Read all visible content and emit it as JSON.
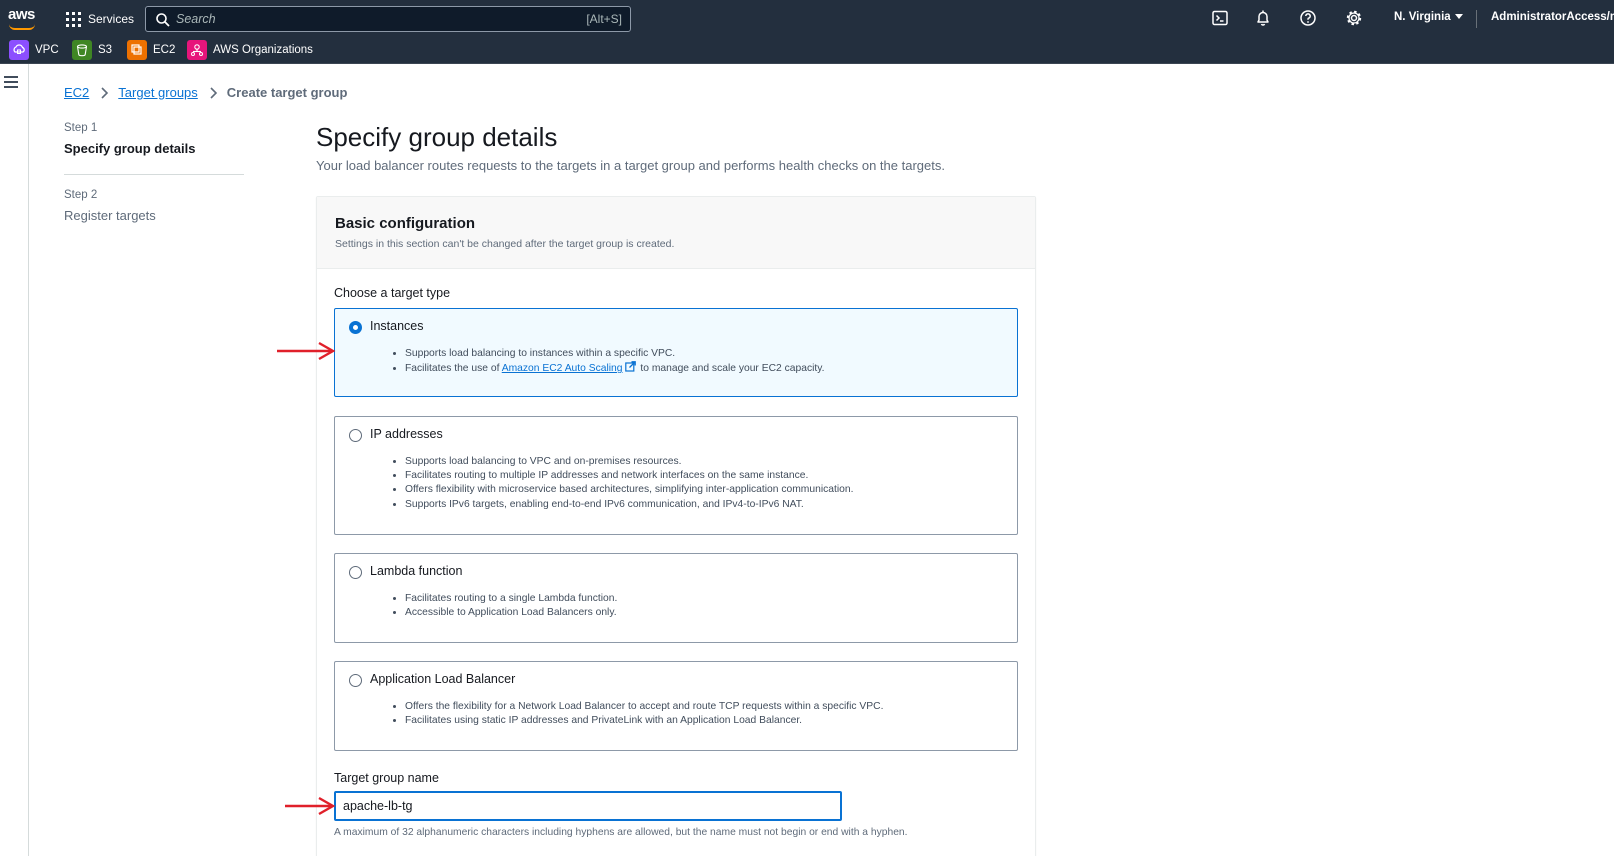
{
  "topnav": {
    "logo_text": "aws",
    "services_label": "Services",
    "search_placeholder": "Search",
    "search_shortcut": "[Alt+S]",
    "region": "N. Virginia",
    "account": "AdministratorAccess/my",
    "icons": [
      "cloudshell-icon",
      "notifications-icon",
      "help-icon",
      "settings-icon"
    ]
  },
  "favorites": [
    {
      "label": "VPC",
      "color": "#8c4fff"
    },
    {
      "label": "S3",
      "color": "#3f8624"
    },
    {
      "label": "EC2",
      "color": "#ed7100"
    },
    {
      "label": "AWS Organizations",
      "color": "#e7157b"
    }
  ],
  "breadcrumb": {
    "items": [
      "EC2",
      "Target groups"
    ],
    "current": "Create target group"
  },
  "steps": [
    {
      "label": "Step 1",
      "title": "Specify group details",
      "active": true
    },
    {
      "label": "Step 2",
      "title": "Register targets",
      "active": false
    }
  ],
  "main": {
    "title": "Specify group details",
    "description": "Your load balancer routes requests to the targets in a target group and performs health checks on the targets."
  },
  "panel": {
    "title": "Basic configuration",
    "subtitle": "Settings in this section can't be changed after the target group is created.",
    "target_type_label": "Choose a target type",
    "target_types": [
      {
        "title": "Instances",
        "selected": true,
        "bullets": [
          "Supports load balancing to instances within a specific VPC."
        ],
        "link_bullet": {
          "prefix": "Facilitates the use of ",
          "link": "Amazon EC2 Auto Scaling",
          "suffix": " to manage and scale your EC2 capacity."
        }
      },
      {
        "title": "IP addresses",
        "selected": false,
        "bullets": [
          "Supports load balancing to VPC and on-premises resources.",
          "Facilitates routing to multiple IP addresses and network interfaces on the same instance.",
          "Offers flexibility with microservice based architectures, simplifying inter-application communication.",
          "Supports IPv6 targets, enabling end-to-end IPv6 communication, and IPv4-to-IPv6 NAT."
        ]
      },
      {
        "title": "Lambda function",
        "selected": false,
        "bullets": [
          "Facilitates routing to a single Lambda function.",
          "Accessible to Application Load Balancers only."
        ]
      },
      {
        "title": "Application Load Balancer",
        "selected": false,
        "bullets": [
          "Offers the flexibility for a Network Load Balancer to accept and route TCP requests within a specific VPC.",
          "Facilitates using static IP addresses and PrivateLink with an Application Load Balancer."
        ]
      }
    ],
    "name_label": "Target group name",
    "name_value": "apache-lb-tg",
    "name_constraint": "A maximum of 32 alphanumeric characters including hyphens are allowed, but the name must not begin or end with a hyphen."
  },
  "colors": {
    "nav_bg": "#232f3e",
    "accent": "#0972d3",
    "selected_bg": "#f1faff",
    "annotation_arrow": "#e0202a"
  }
}
